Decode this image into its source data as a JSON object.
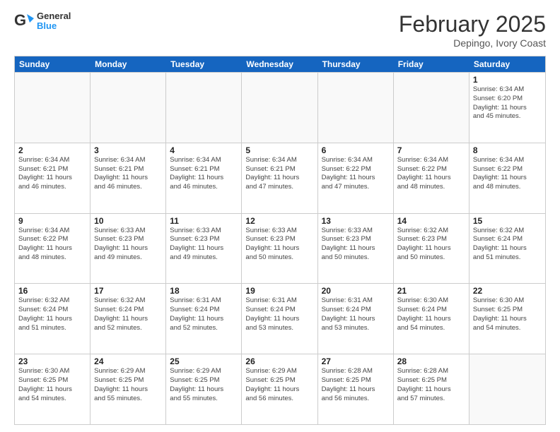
{
  "logo": {
    "text1": "General",
    "text2": "Blue"
  },
  "title": "February 2025",
  "location": "Depingo, Ivory Coast",
  "day_headers": [
    "Sunday",
    "Monday",
    "Tuesday",
    "Wednesday",
    "Thursday",
    "Friday",
    "Saturday"
  ],
  "weeks": [
    [
      {
        "day": "",
        "info": ""
      },
      {
        "day": "",
        "info": ""
      },
      {
        "day": "",
        "info": ""
      },
      {
        "day": "",
        "info": ""
      },
      {
        "day": "",
        "info": ""
      },
      {
        "day": "",
        "info": ""
      },
      {
        "day": "1",
        "info": "Sunrise: 6:34 AM\nSunset: 6:20 PM\nDaylight: 11 hours\nand 45 minutes."
      }
    ],
    [
      {
        "day": "2",
        "info": "Sunrise: 6:34 AM\nSunset: 6:21 PM\nDaylight: 11 hours\nand 46 minutes."
      },
      {
        "day": "3",
        "info": "Sunrise: 6:34 AM\nSunset: 6:21 PM\nDaylight: 11 hours\nand 46 minutes."
      },
      {
        "day": "4",
        "info": "Sunrise: 6:34 AM\nSunset: 6:21 PM\nDaylight: 11 hours\nand 46 minutes."
      },
      {
        "day": "5",
        "info": "Sunrise: 6:34 AM\nSunset: 6:21 PM\nDaylight: 11 hours\nand 47 minutes."
      },
      {
        "day": "6",
        "info": "Sunrise: 6:34 AM\nSunset: 6:22 PM\nDaylight: 11 hours\nand 47 minutes."
      },
      {
        "day": "7",
        "info": "Sunrise: 6:34 AM\nSunset: 6:22 PM\nDaylight: 11 hours\nand 48 minutes."
      },
      {
        "day": "8",
        "info": "Sunrise: 6:34 AM\nSunset: 6:22 PM\nDaylight: 11 hours\nand 48 minutes."
      }
    ],
    [
      {
        "day": "9",
        "info": "Sunrise: 6:34 AM\nSunset: 6:22 PM\nDaylight: 11 hours\nand 48 minutes."
      },
      {
        "day": "10",
        "info": "Sunrise: 6:33 AM\nSunset: 6:23 PM\nDaylight: 11 hours\nand 49 minutes."
      },
      {
        "day": "11",
        "info": "Sunrise: 6:33 AM\nSunset: 6:23 PM\nDaylight: 11 hours\nand 49 minutes."
      },
      {
        "day": "12",
        "info": "Sunrise: 6:33 AM\nSunset: 6:23 PM\nDaylight: 11 hours\nand 50 minutes."
      },
      {
        "day": "13",
        "info": "Sunrise: 6:33 AM\nSunset: 6:23 PM\nDaylight: 11 hours\nand 50 minutes."
      },
      {
        "day": "14",
        "info": "Sunrise: 6:32 AM\nSunset: 6:23 PM\nDaylight: 11 hours\nand 50 minutes."
      },
      {
        "day": "15",
        "info": "Sunrise: 6:32 AM\nSunset: 6:24 PM\nDaylight: 11 hours\nand 51 minutes."
      }
    ],
    [
      {
        "day": "16",
        "info": "Sunrise: 6:32 AM\nSunset: 6:24 PM\nDaylight: 11 hours\nand 51 minutes."
      },
      {
        "day": "17",
        "info": "Sunrise: 6:32 AM\nSunset: 6:24 PM\nDaylight: 11 hours\nand 52 minutes."
      },
      {
        "day": "18",
        "info": "Sunrise: 6:31 AM\nSunset: 6:24 PM\nDaylight: 11 hours\nand 52 minutes."
      },
      {
        "day": "19",
        "info": "Sunrise: 6:31 AM\nSunset: 6:24 PM\nDaylight: 11 hours\nand 53 minutes."
      },
      {
        "day": "20",
        "info": "Sunrise: 6:31 AM\nSunset: 6:24 PM\nDaylight: 11 hours\nand 53 minutes."
      },
      {
        "day": "21",
        "info": "Sunrise: 6:30 AM\nSunset: 6:24 PM\nDaylight: 11 hours\nand 54 minutes."
      },
      {
        "day": "22",
        "info": "Sunrise: 6:30 AM\nSunset: 6:25 PM\nDaylight: 11 hours\nand 54 minutes."
      }
    ],
    [
      {
        "day": "23",
        "info": "Sunrise: 6:30 AM\nSunset: 6:25 PM\nDaylight: 11 hours\nand 54 minutes."
      },
      {
        "day": "24",
        "info": "Sunrise: 6:29 AM\nSunset: 6:25 PM\nDaylight: 11 hours\nand 55 minutes."
      },
      {
        "day": "25",
        "info": "Sunrise: 6:29 AM\nSunset: 6:25 PM\nDaylight: 11 hours\nand 55 minutes."
      },
      {
        "day": "26",
        "info": "Sunrise: 6:29 AM\nSunset: 6:25 PM\nDaylight: 11 hours\nand 56 minutes."
      },
      {
        "day": "27",
        "info": "Sunrise: 6:28 AM\nSunset: 6:25 PM\nDaylight: 11 hours\nand 56 minutes."
      },
      {
        "day": "28",
        "info": "Sunrise: 6:28 AM\nSunset: 6:25 PM\nDaylight: 11 hours\nand 57 minutes."
      },
      {
        "day": "",
        "info": ""
      }
    ]
  ]
}
